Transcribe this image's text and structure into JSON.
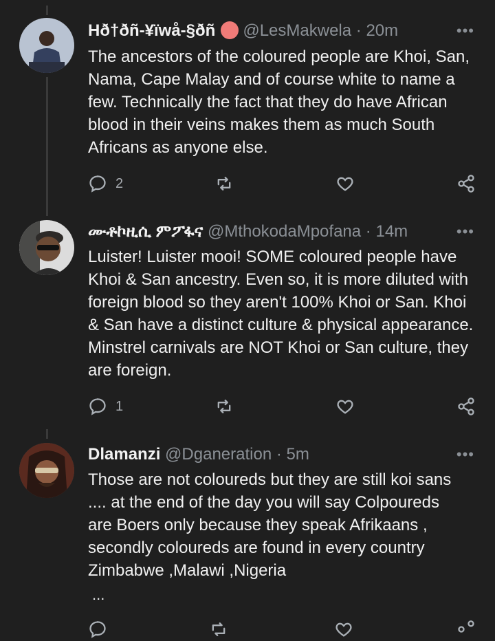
{
  "tweets": [
    {
      "display_name": "Hð†ðñ-¥ïwå-§ðñ",
      "handle": "@LesMakwela",
      "separator": "·",
      "time": "20m",
      "more": "•••",
      "badge_color": "#f07b78",
      "text": "The ancestors of the coloured people are Khoi, San, Nama, Cape Malay and of course white to name a few. Technically the fact that they do have African blood in their veins makes them as much South Africans as anyone else.",
      "reply_count": "2",
      "avatar_color": "#7b8aa3"
    },
    {
      "display_name": "ሙቶኮዚሲ ምፖፋና",
      "handle": "@MthokodaMpofana",
      "separator": "·",
      "time": "14m",
      "more": "•••",
      "text": "Luister! Luister mooi! SOME coloured people have Khoi & San ancestry. Even so, it is more diluted with foreign blood so they aren't 100% Khoi or San. Khoi & San have a distinct culture & physical appearance. Minstrel carnivals are NOT Khoi or San culture, they are foreign.",
      "reply_count": "1",
      "avatar_color": "#6e6a62"
    },
    {
      "display_name": "Dlamanzi",
      "handle": "@Dganeration",
      "separator": "·",
      "time": "5m",
      "more": "•••",
      "text_lines": [
        "Those are not coloureds but they are still koi sans",
        ".... at the end of the day you will say  Colpoureds",
        "are Boers  only because they speak  Afrikaans ,",
        "secondly coloureds are found in every country",
        "Zimbabwe ,Malawi ,Nigeria"
      ],
      "truncation": "...",
      "avatar_color": "#7a3b2a"
    }
  ],
  "icons": [
    "reply-icon",
    "retweet-icon",
    "like-icon",
    "share-icon",
    "more-icon"
  ],
  "colors": {
    "background": "#1f1f1f",
    "muted": "#8b9096",
    "text": "#f0f0f0"
  }
}
